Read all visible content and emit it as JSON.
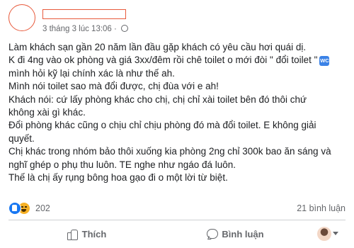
{
  "post": {
    "timestamp": "3 tháng 3 lúc 13:06",
    "privacy_icon": "globe-icon",
    "lines": [
      "Làm khách sạn gần 20 năm lần đầu gặp khách có yêu cầu hơi quái dị.",
      "K đi 4ng vào ok phòng và giá 3xx/đêm rồi chê toilet o mới đòi \" đổi toilet \"",
      "mình hỏi kỹ lại chính xác là như thế ah.",
      "Mình nói toilet sao mà đổi được, chị đùa với e ah!",
      "Khách nói: cứ lấy phòng khác cho chị, chị chỉ xài toilet bên đó thôi chứ",
      "không xài gì khác.",
      "Đổi phòng khác cũng o chịu chỉ chịu phòng đó mà đổi toilet. E không giải",
      "quyết.",
      "Chị khác trong nhóm bảo thôi xuống kia phòng 2ng chỉ 300k bao ăn sáng và",
      "nghĩ ghép o phụ thu luôn. TE nghe như ngáo đá luôn.",
      "Thế là chị ấy rụng bông hoa gạo đi o một lời từ biệt."
    ],
    "wc_badge": "WC"
  },
  "stats": {
    "reaction_count": "202",
    "comment_count": "21 bình luận",
    "reactions": [
      "like",
      "haha"
    ]
  },
  "actions": {
    "like_label": "Thích",
    "comment_label": "Bình luận"
  },
  "colors": {
    "redaction_outline": "#e85a3c",
    "like_blue": "#1877f2",
    "haha_yellow": "#f7b125",
    "muted_text": "#65676b"
  }
}
